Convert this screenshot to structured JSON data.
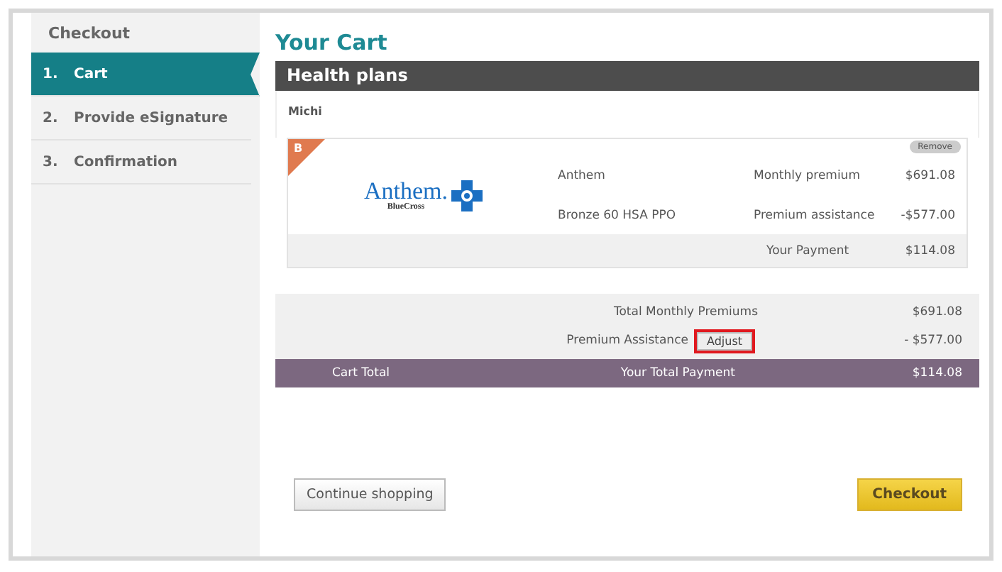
{
  "sidebar": {
    "title": "Checkout",
    "steps": [
      {
        "number": "1.",
        "label": "Cart",
        "selected": true
      },
      {
        "number": "2.",
        "label": "Provide eSignature",
        "selected": false
      },
      {
        "number": "3.",
        "label": "Confirmation",
        "selected": false
      }
    ]
  },
  "page_title": "Your Cart",
  "section": {
    "title": "Health plans",
    "member": "Michi"
  },
  "plan": {
    "tier_badge": "B",
    "logo_name": "Anthem.",
    "logo_sub": "BlueCross",
    "remove_label": "Remove",
    "carrier": "Anthem",
    "plan_name": "Bronze 60 HSA PPO",
    "lines": [
      {
        "label": "Monthly premium",
        "amount": "$691.08"
      },
      {
        "label": "Premium assistance",
        "amount": "-$577.00"
      }
    ],
    "payment": {
      "label": "Your Payment",
      "amount": "$114.08"
    }
  },
  "totals": [
    {
      "label": "Total Monthly Premiums",
      "amount": "$691.08"
    },
    {
      "label": "Premium Assistance",
      "amount": "- $577.00",
      "button": "Adjust",
      "highlighted": true
    }
  ],
  "cart_total": {
    "label": "Cart Total",
    "payment_label": "Your Total Payment",
    "amount": "$114.08"
  },
  "buttons": {
    "secondary": "Continue shopping",
    "primary": "Checkout"
  }
}
